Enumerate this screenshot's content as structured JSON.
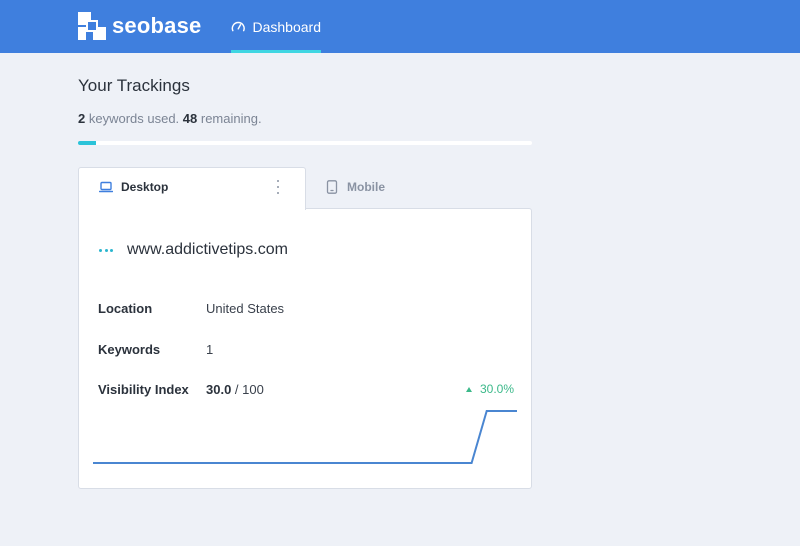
{
  "app": {
    "name": "seobase",
    "brand_color": "#3f7fde",
    "accent_color": "#3fd6e2",
    "logo_icon": "seobase-logo-icon"
  },
  "nav": {
    "tabs": [
      {
        "label": "Dashboard",
        "icon": "gauge-icon",
        "active": true
      }
    ]
  },
  "header": {
    "title": "Your Trackings",
    "usage": {
      "used": "2",
      "used_suffix": " keywords used. ",
      "remaining": "48",
      "remaining_suffix": " remaining.",
      "progress_fraction": 0.04
    }
  },
  "tabs": [
    {
      "label": "Desktop",
      "icon": "laptop-icon",
      "active": true
    },
    {
      "label": "Mobile",
      "icon": "mobile-icon",
      "active": false
    }
  ],
  "tracking": {
    "domain": "www.addictivetips.com",
    "location_label": "Location",
    "location_value": "United States",
    "keywords_label": "Keywords",
    "keywords_value": "1",
    "visibility_label": "Visibility Index",
    "visibility_value": "30.0",
    "visibility_max": " / 100",
    "visibility_change": "30.0%",
    "change_color": "#3cb98a",
    "line_color": "#4a86d1",
    "sparkline": [
      0,
      0,
      0,
      0,
      0,
      0,
      0,
      0,
      0,
      0,
      0,
      0,
      0,
      0,
      0,
      0,
      0,
      0,
      0,
      0,
      0,
      0,
      0,
      0,
      0,
      0,
      30,
      30,
      30
    ]
  }
}
